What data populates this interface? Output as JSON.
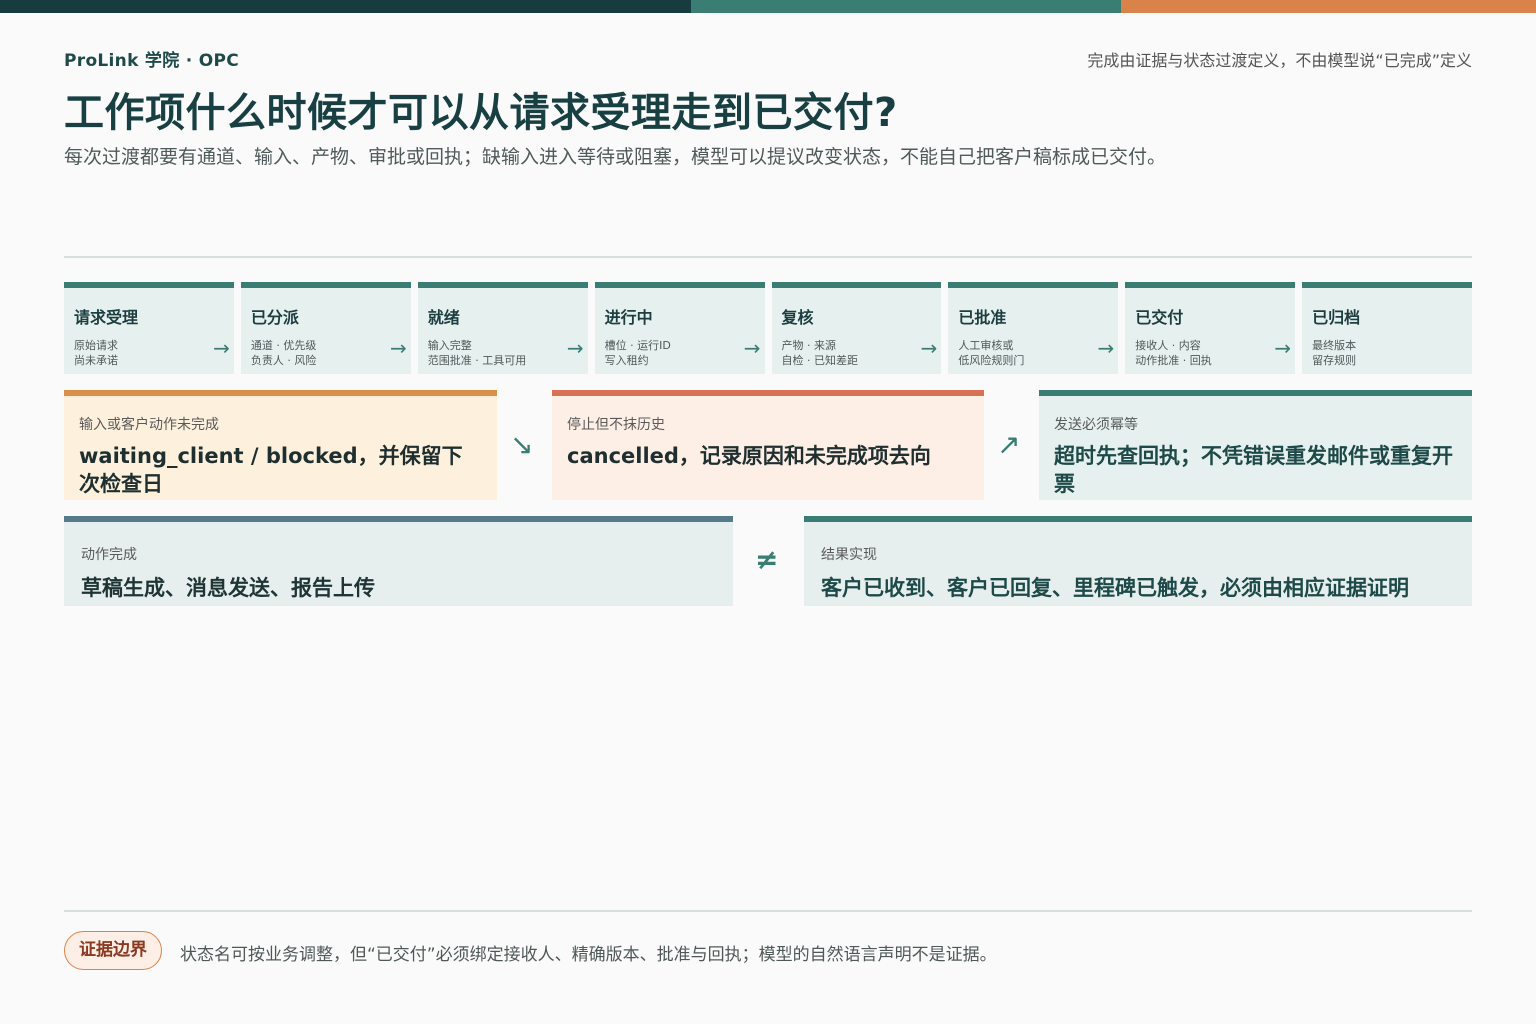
{
  "header": {
    "brand": "ProLink 学院 · OPC",
    "tagline": "完成由证据与状态过渡定义，不由模型说“已完成”定义",
    "title": "工作项什么时候才可以从请求受理走到已交付?",
    "subtitle": "每次过渡都要有通道、输入、产物、审批或回执；缺输入进入等待或阻塞，模型可以提议改变状态，不能自己把客户稿标成已交付。"
  },
  "colors": {
    "brand_dark": "#163c40",
    "teal": "#3a7d72",
    "orange": "#d9834a",
    "coral": "#d77255",
    "slate": "#557b8a"
  },
  "stages": [
    {
      "name": "请求受理",
      "note1": "原始请求",
      "note2": "尚未承诺",
      "arrow": "→"
    },
    {
      "name": "已分派",
      "note1": "通道 · 优先级",
      "note2": "负责人 · 风险",
      "arrow": "→"
    },
    {
      "name": "就绪",
      "note1": "输入完整",
      "note2": "范围批准 · 工具可用",
      "arrow": "→"
    },
    {
      "name": "进行中",
      "note1": "槽位 · 运行ID",
      "note2": "写入租约",
      "arrow": "→"
    },
    {
      "name": "复核",
      "note1": "产物 · 来源",
      "note2": "自检 · 已知差距",
      "arrow": "→"
    },
    {
      "name": "已批准",
      "note1": "人工审核或",
      "note2": "低风险规则门",
      "arrow": "→"
    },
    {
      "name": "已交付",
      "note1": "接收人 · 内容",
      "note2": "动作批准 · 回执",
      "arrow": "→"
    },
    {
      "name": "已归档",
      "note1": "最终版本",
      "note2": "留存规则",
      "arrow": ""
    }
  ],
  "exceptions": [
    {
      "small": "输入或客户动作未完成",
      "big": "waiting_client / blocked，并保留下次检查日"
    },
    {
      "small": "停止但不抹历史",
      "big": "cancelled，记录原因和未完成项去向"
    },
    {
      "small": "发送必须幂等",
      "big": "超时先查回执；不凭错误重发邮件或重复开票"
    }
  ],
  "arrows": {
    "down": "↘",
    "up": "↗",
    "neq": "≠"
  },
  "compare": {
    "left": {
      "small": "动作完成",
      "big": "草稿生成、消息发送、报告上传"
    },
    "right": {
      "small": "结果实现",
      "big": "客户已收到、客户已回复、里程碑已触发，必须由相应证据证明"
    }
  },
  "footer": {
    "badge": "证据边界",
    "text": "状态名可按业务调整，但“已交付”必须绑定接收人、精确版本、批准与回执；模型的自然语言声明不是证据。"
  }
}
